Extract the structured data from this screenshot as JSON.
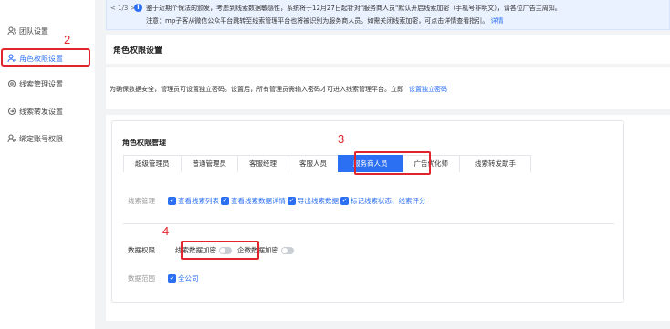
{
  "sidebar": {
    "items": [
      {
        "label": "团队设置",
        "icon": "team-icon"
      },
      {
        "label": "角色权限设置",
        "icon": "user-role-icon"
      },
      {
        "label": "线索管理设置",
        "icon": "gear-icon"
      },
      {
        "label": "线索转发设置",
        "icon": "forward-icon"
      },
      {
        "label": "绑定账号权限",
        "icon": "bind-user-icon"
      }
    ]
  },
  "annotations": {
    "a2": "2",
    "a3": "3",
    "a4": "4"
  },
  "notice": {
    "pager": "< 1/3 >",
    "line1": "鉴于近期个保法的颁发，考虑到线索数据敏感性，系统将于12月27日起针对\"服务商人员\"默认开启线索加密（手机号非明文），请各位广告主周知。",
    "line2": "注意：mp子客从微信公众平台跳转至线索管理平台也将被识别为服务商人员。如需关闭线索加密，可点击详情查看指引。",
    "link": "详情"
  },
  "header": {
    "title": "角色权限设置"
  },
  "desc": {
    "text": "为确保数据安全，管理员可设置独立密码。设置后，所有管理员需输入密码才可进入线索管理平台。立即",
    "link": "设置独立密码"
  },
  "main": {
    "section_title": "角色权限管理",
    "tabs": [
      "超级管理员",
      "普通管理员",
      "客服经理",
      "客服人员",
      "服务商人员",
      "广告优化师",
      "线索转发助手"
    ],
    "active_tab": 4,
    "lead_mgmt_label": "线索管理",
    "lead_perms": [
      "查看线索列表",
      "查看线索数据详情",
      "导出线索数据",
      "标记线索状态、线索评分"
    ],
    "data_perm_label": "数据权限",
    "toggles": [
      "线索数据加密",
      "企微数据加密"
    ],
    "scope_label": "数据范围",
    "scope_value": "全公司"
  },
  "colors": {
    "accent": "#2b6ff3",
    "highlight": "#e0262c"
  }
}
